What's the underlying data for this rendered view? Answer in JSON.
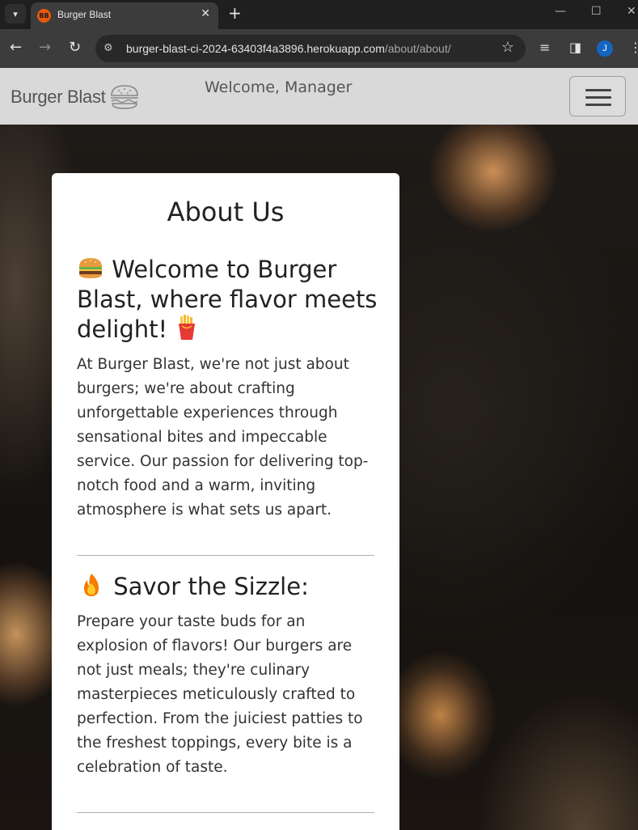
{
  "browser": {
    "tab_title": "Burger Blast",
    "favicon_text": "BB",
    "url_host": "burger-blast-ci-2024-63403f4a3896.herokuapp.com",
    "url_path": "/about/about/",
    "profile_initial": "J"
  },
  "navbar": {
    "brand": "Burger Blast",
    "welcome": "Welcome, Manager"
  },
  "card": {
    "title": "About Us",
    "sections": [
      {
        "heading": "Welcome to Burger Blast, where flavor meets delight!",
        "body": "At Burger Blast, we're not just about burgers; we're about crafting unforgettable experiences through sensational bites and impeccable service. Our passion for delivering top-notch food and a warm, inviting atmosphere is what sets us apart."
      },
      {
        "heading": "Savor the Sizzle:",
        "body": "Prepare your taste buds for an explosion of flavors! Our burgers are not just meals; they're culinary masterpieces meticulously crafted to perfection. From the juiciest patties to the freshest toppings, every bite is a celebration of taste."
      }
    ]
  },
  "colors": {
    "accent": "#e8590c",
    "navbar_bg": "#d9d9d9",
    "card_bg": "#ffffff"
  }
}
